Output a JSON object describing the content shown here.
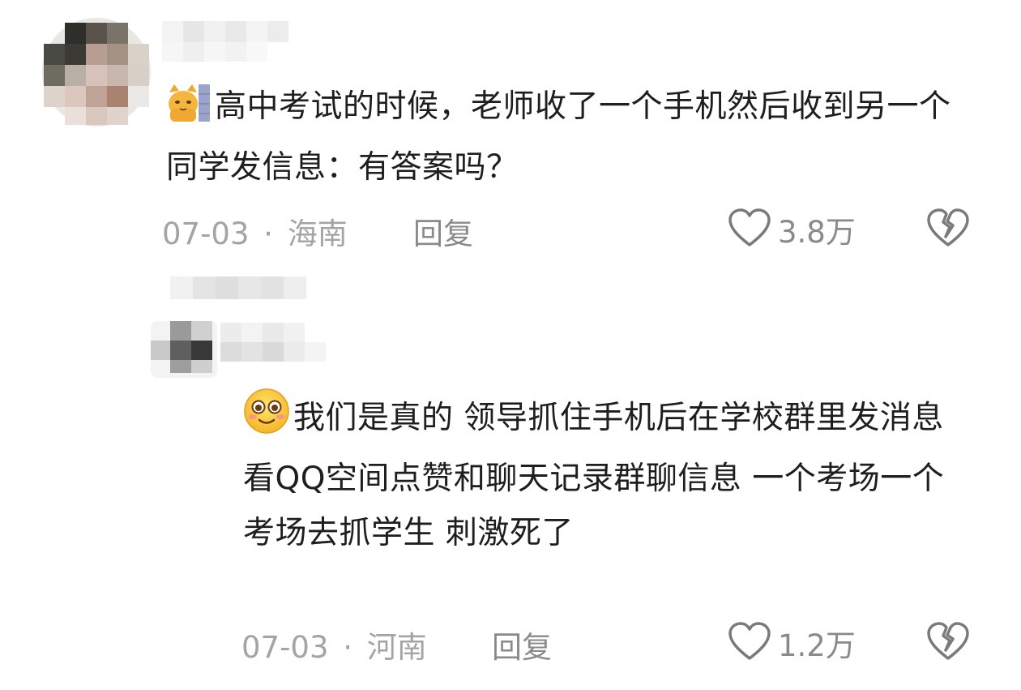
{
  "comments": [
    {
      "text": "高中考试的时候，老师收了一个手机然后收到另一个同学发信息：有答案吗？",
      "emoji": "cat-face-icon",
      "date": "07-03",
      "separator": "·",
      "location": "海南",
      "reply_label": "回复",
      "like_count": "3.8万"
    },
    {
      "text": "我们是真的 领导抓住手机后在学校群里发消息 看QQ空间点赞和聊天记录群聊信息 一个考场一个考场去抓学生 刺激死了",
      "emoji": "smiling-face-icon",
      "date": "07-03",
      "separator": "·",
      "location": "河南",
      "reply_label": "回复",
      "like_count": "1.2万"
    }
  ],
  "colors": {
    "text": "#1e1e1e",
    "meta": "#a4a4a4",
    "action": "#8a8a8a"
  }
}
